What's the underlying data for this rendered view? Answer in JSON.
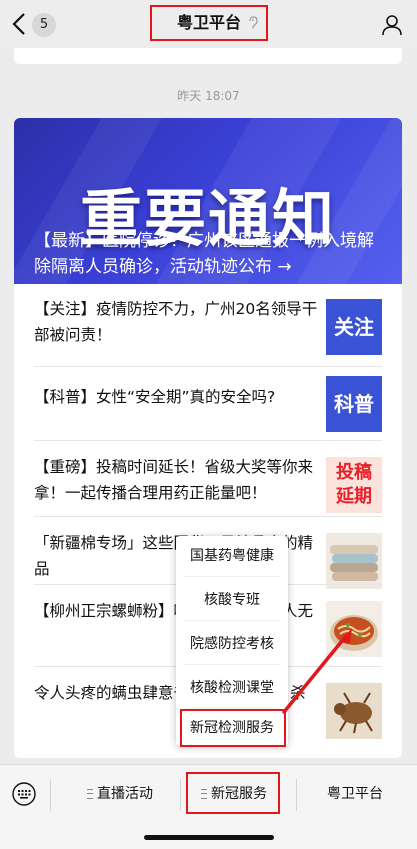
{
  "header": {
    "unread_count": "5",
    "title": "粤卫平台"
  },
  "chat": {
    "timestamp": "昨天 18:07"
  },
  "hero": {
    "headline": "重要通知",
    "caption": "【最新】医院停诊！广州该区通报一例入境解除隔离人员确诊，活动轨迹公布 →"
  },
  "articles": [
    {
      "text": "【关注】疫情防控不力，广州20名领导干部被问责！",
      "thumb_label": "关注",
      "thumb_color": "#3a52d6"
    },
    {
      "text": "【科普】女性“安全期”真的安全吗?",
      "thumb_label": "科普",
      "thumb_color": "#3a52d6"
    },
    {
      "text": "【重磅】投稿时间延长！省级大奖等你来拿！一起传播合理用药正能量吧！",
      "thumb_label": "投稿延期",
      "thumb_color": "#e8202a"
    },
    {
      "text": "「新疆棉专场」这些国货，是精品中的精品",
      "thumb_label": "",
      "thumb_color": "#c9b8a4"
    },
    {
      "text": "【柳州正宗螺蛳粉】嗦一口腿软！凡人无",
      "thumb_label": "",
      "thumb_color": "#c88a3a"
    },
    {
      "text": "令人头疼的螨虫肆意千万螨虫“集体自杀",
      "thumb_label": "",
      "thumb_color": "#8a5a2e"
    }
  ],
  "popup_menu": {
    "items": [
      "国基药粤健康",
      "核酸专班",
      "院感防控考核",
      "核酸检测课堂",
      "新冠检测服务"
    ],
    "highlighted": "新冠检测服务"
  },
  "bottom_menu": {
    "items": [
      "直播活动",
      "新冠服务",
      "粤卫平台"
    ],
    "active": "新冠服务"
  },
  "colors": {
    "highlight": "#e0181b",
    "hero_blue": "#3a40d6"
  }
}
